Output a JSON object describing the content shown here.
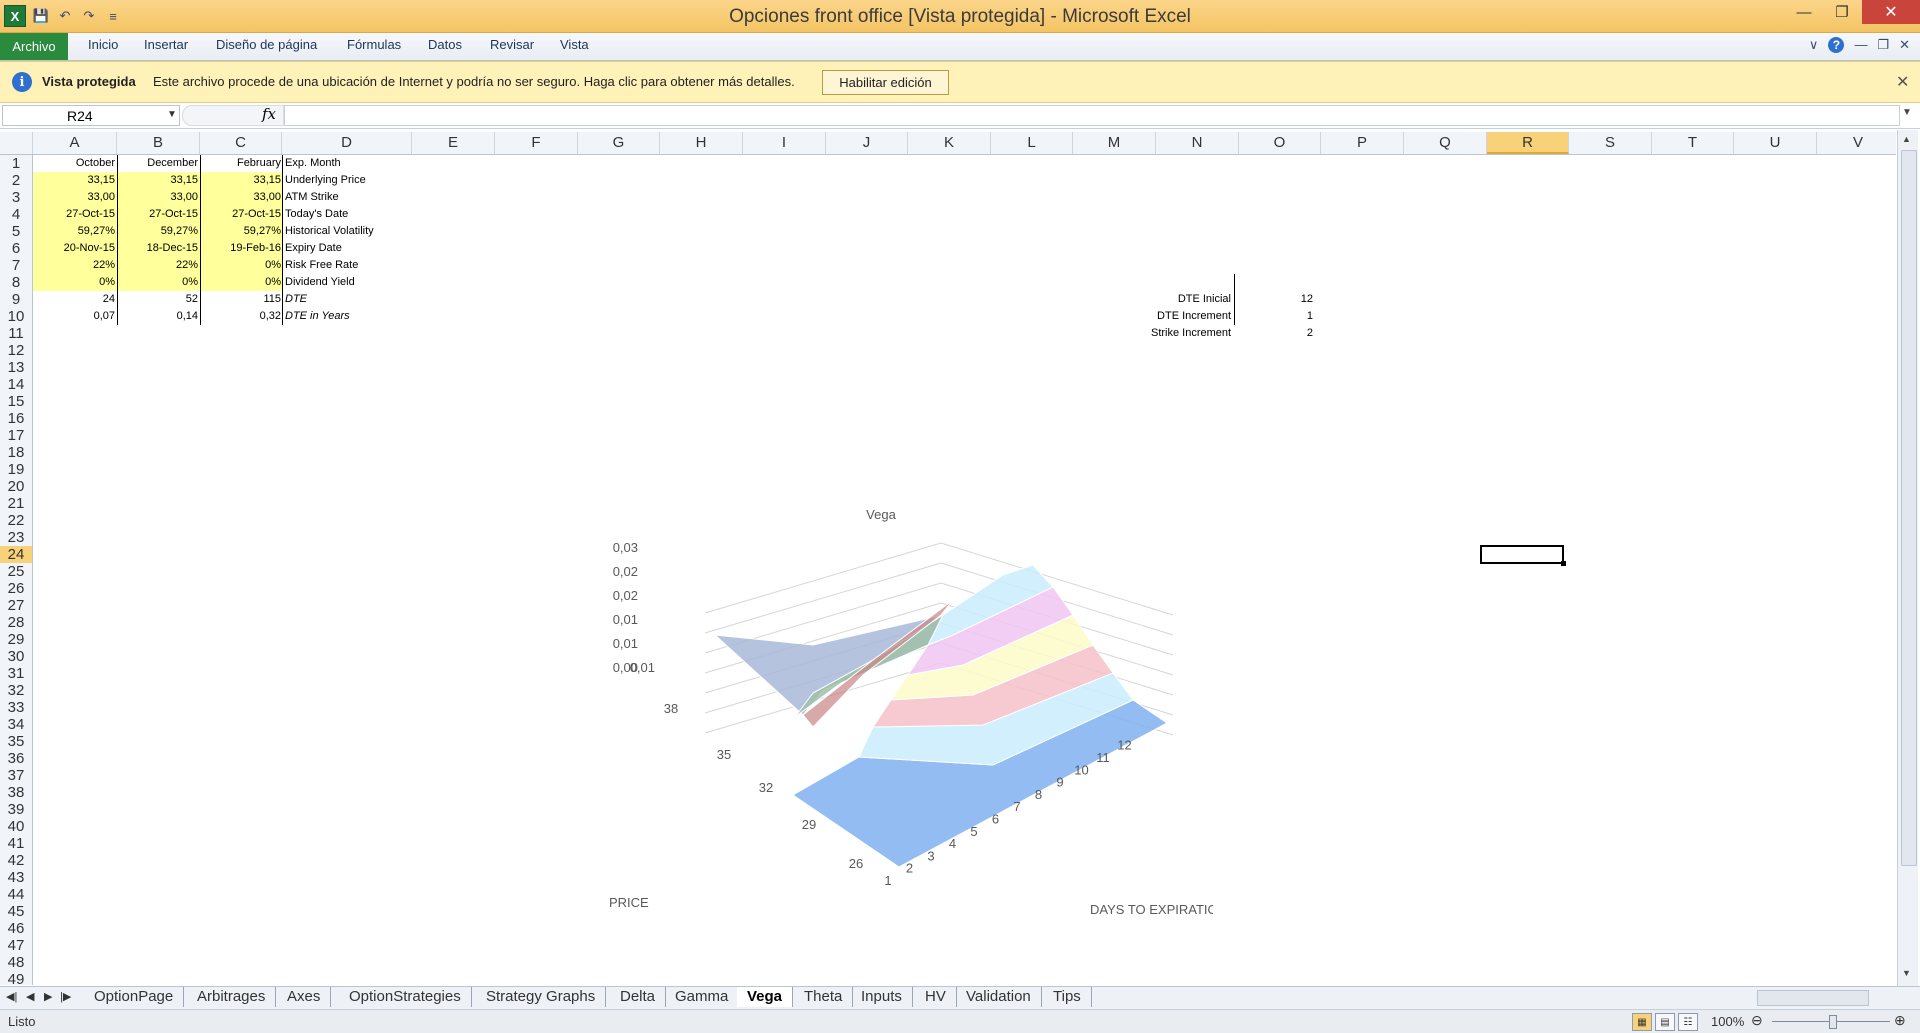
{
  "window": {
    "title": "Opciones front office  [Vista protegida]  -  Microsoft Excel",
    "minimize": "—",
    "maximize": "❐",
    "close": "✕"
  },
  "qat": {
    "logo": "X",
    "save": "💾",
    "undo": "↶",
    "redo": "↷",
    "customize": "≡"
  },
  "ribbon": {
    "file": "Archivo",
    "tabs": [
      "Inicio",
      "Insertar",
      "Diseño de página",
      "Fórmulas",
      "Datos",
      "Revisar",
      "Vista"
    ],
    "help": "?"
  },
  "protected_bar": {
    "title": "Vista protegida",
    "message": "Este archivo procede de una ubicación de Internet y podría no ser seguro. Haga clic para obtener más detalles.",
    "button": "Habilitar edición",
    "close": "✕"
  },
  "formula_bar": {
    "name_box": "R24",
    "fx": "fx",
    "formula": ""
  },
  "columns": [
    "A",
    "B",
    "C",
    "D",
    "E",
    "F",
    "G",
    "H",
    "I",
    "J",
    "K",
    "L",
    "M",
    "N",
    "O",
    "P",
    "Q",
    "R",
    "S",
    "T",
    "U",
    "V"
  ],
  "selected_column": "R",
  "selected_row": 24,
  "rows": [
    "1",
    "2",
    "3",
    "4",
    "5",
    "6",
    "7",
    "8",
    "9",
    "10",
    "11",
    "12",
    "13",
    "14",
    "15",
    "16",
    "17",
    "18",
    "19",
    "20",
    "21",
    "22",
    "23",
    "24",
    "25",
    "26",
    "27",
    "28",
    "29",
    "30",
    "31",
    "32",
    "33",
    "34",
    "35",
    "36",
    "37",
    "38",
    "39",
    "40",
    "41",
    "42",
    "43",
    "44",
    "45",
    "46",
    "47",
    "48",
    "49"
  ],
  "table": {
    "header": [
      "October",
      "December",
      "February",
      "Exp. Month"
    ],
    "rows": [
      [
        "33,15",
        "33,15",
        "33,15",
        "Underlying Price"
      ],
      [
        "33,00",
        "33,00",
        "33,00",
        "ATM Strike"
      ],
      [
        "27-Oct-15",
        "27-Oct-15",
        "27-Oct-15",
        "Today's Date"
      ],
      [
        "59,27%",
        "59,27%",
        "59,27%",
        "Historical Volatility"
      ],
      [
        "20-Nov-15",
        "18-Dec-15",
        "19-Feb-16",
        "Expiry Date"
      ],
      [
        "22%",
        "22%",
        "0%",
        "Risk Free Rate"
      ],
      [
        "0%",
        "0%",
        "0%",
        "Dividend Yield"
      ],
      [
        "24",
        "52",
        "115",
        "DTE"
      ],
      [
        "0,07",
        "0,14",
        "0,32",
        "DTE in Years"
      ]
    ]
  },
  "params": [
    {
      "label": "DTE Inicial",
      "value": "12"
    },
    {
      "label": "DTE Increment",
      "value": "1"
    },
    {
      "label": "Strike Increment",
      "value": "2"
    }
  ],
  "chart_data": {
    "type": "surface",
    "title": "Vega",
    "xlabel": "DAYS TO EXPIRATION",
    "ylabel": "PRICE",
    "x": [
      1,
      2,
      3,
      4,
      5,
      6,
      7,
      8,
      9,
      10,
      11,
      12
    ],
    "y": [
      26,
      29,
      32,
      35,
      38
    ],
    "z_ticks": [
      "0,03",
      "0,02",
      "0,02",
      "0,01",
      "0,01",
      "0,00",
      "0,01"
    ],
    "colors": [
      "#7fb0f0",
      "#c9ecfb",
      "#f6c0c8",
      "#fbfbc8",
      "#f0c6f3",
      "#9fc1a8",
      "#a8b8d8"
    ]
  },
  "sheets": [
    "OptionPage",
    "Arbitrages",
    "Axes",
    "OptionStrategies",
    "Strategy Graphs",
    "Delta",
    "Gamma",
    "Vega",
    "Theta",
    "Inputs",
    "HV",
    "Validation",
    "Tips"
  ],
  "active_sheet": "Vega",
  "status": {
    "text": "Listo",
    "zoom": "100%",
    "minus": "⊖",
    "plus": "⊕"
  }
}
